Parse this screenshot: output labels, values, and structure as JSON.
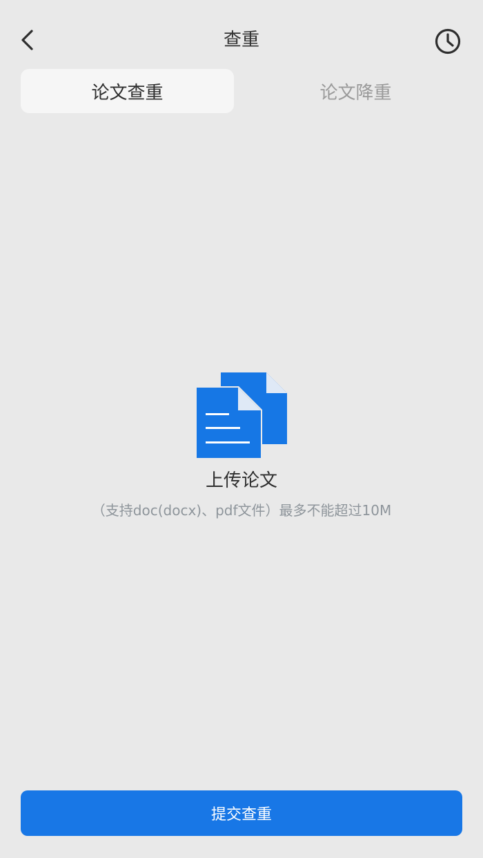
{
  "header": {
    "title": "查重",
    "back_icon": "chevron-left-icon",
    "history_icon": "clock-icon"
  },
  "tabs": [
    {
      "label": "论文查重",
      "active": true
    },
    {
      "label": "论文降重",
      "active": false
    }
  ],
  "upload": {
    "icon": "documents-icon",
    "title": "上传论文",
    "hint": "（支持doc(docx)、pdf文件）最多不能超过10M"
  },
  "submit": {
    "label": "提交查重"
  },
  "colors": {
    "background": "#e9e9e9",
    "accent": "#1877e6",
    "tab_active_bg": "#f6f6f6",
    "text_primary": "#2e2e2e",
    "text_secondary": "#9a9a9a"
  }
}
